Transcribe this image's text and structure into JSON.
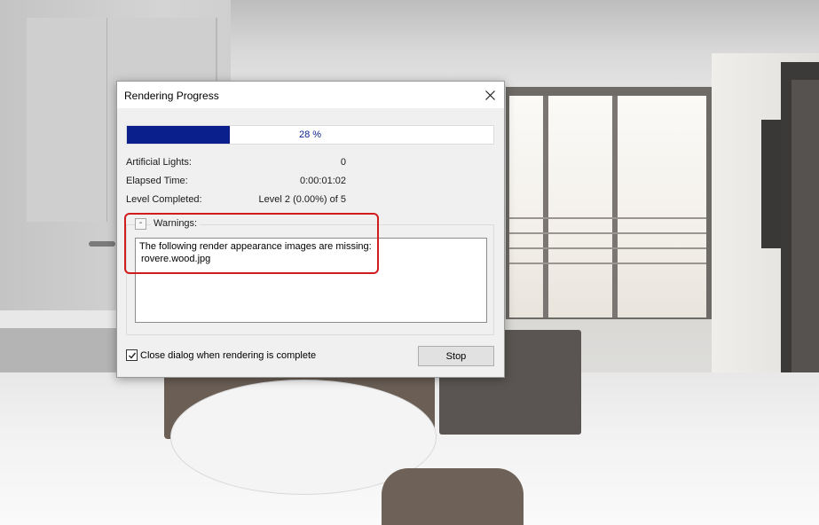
{
  "dialog": {
    "title": "Rendering Progress",
    "close_icon": "close-icon",
    "progress": {
      "value_percent": 28,
      "label": "28 %",
      "fill_color": "#0a1e8c"
    },
    "stats": [
      {
        "label": "Artificial Lights:",
        "value": "0"
      },
      {
        "label": "Elapsed Time:",
        "value": "0:00:01:02"
      },
      {
        "label": "Level Completed:",
        "value": "Level 2 (0.00%) of 5"
      }
    ],
    "warnings": {
      "toggle_symbol": "-",
      "label": "Warnings:",
      "lines": [
        "The following render appearance images are missing:",
        "rovere.wood.jpg"
      ]
    },
    "close_when_complete": {
      "checked": true,
      "label": "Close dialog when rendering is complete"
    },
    "stop_label": "Stop"
  },
  "colors": {
    "highlight": "#d01c1c",
    "progress_fill": "#0a1e8c"
  }
}
